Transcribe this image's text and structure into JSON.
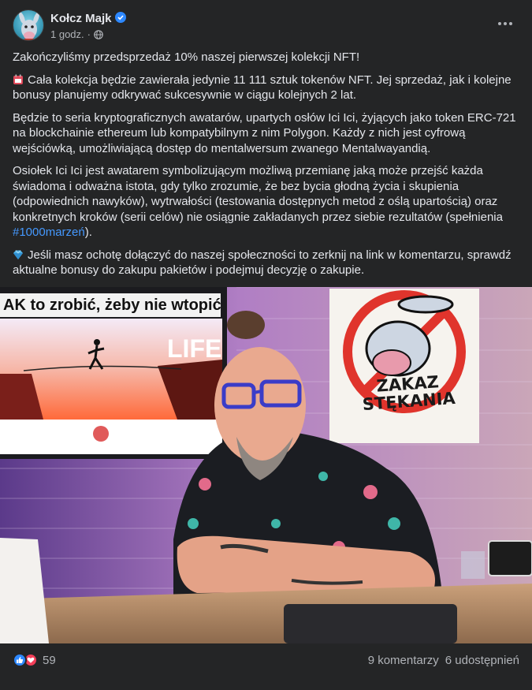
{
  "post": {
    "author": "Kołcz Majk",
    "time": "1 godz.",
    "paragraphs": [
      "Zakończyliśmy przedsprzedaż 10% naszej pierwszej kolekcji NFT!",
      "Cała kolekcja będzie zawierała jedynie 11 111 sztuk tokenów NFT. Jej sprzedaż, jak i kolejne bonusy planujemy odkrywać sukcesywnie w ciągu kolejnych 2 lat.",
      "Będzie to seria kryptograficznych awatarów, upartych osłów Ici Ici, żyjących jako token ERC-721 na blockchainie ethereum lub kompatybilnym z nim Polygon. Każdy z nich jest cyfrową wejściówką, umożliwiającą dostęp do mentalwersum zwanego Mentalwayandią.",
      "Osiołek Ici Ici jest awatarem symbolizującym możliwą przemianę jaką może przejść każda świadoma i odważna istota, gdy tylko zrozumie, że bez bycia głodną życia i skupienia (odpowiednich nawyków), wytrwałości (testowania dostępnych metod z oślą upartością) oraz konkretnych kroków (serii celów) nie osiągnie zakładanych przez siebie rezultatów (spełnienia ",
      "Jeśli masz ochotę dołączyć do naszej społeczności to zerknij na link w komentarzu, sprawdź aktualne bonusy do zakupu pakietów i podejmuj decyzję o zakupie."
    ],
    "hashtag": "#1000marzeń",
    "paragraph4_end": ").",
    "photo": {
      "tv_title": "AK to zrobić, żeby nie wtopić?",
      "tv_word": "LIFE",
      "sign_line1": "ZAKAZ",
      "sign_line2": "STĘKANIA"
    },
    "reaction_count": "59",
    "comments": "9 komentarzy",
    "shares": "6 udostępnień"
  },
  "colors": {
    "background": "#242526",
    "text": "#e4e6eb",
    "secondary": "#b0b3b8",
    "link": "#4599ff",
    "like": "#2d88ff",
    "love": "#f33e58"
  },
  "icons": [
    "verified-badge-icon",
    "globe-icon",
    "more-options-icon",
    "calendar-emoji-icon",
    "gem-emoji-icon",
    "like-reaction-icon",
    "love-reaction-icon"
  ]
}
